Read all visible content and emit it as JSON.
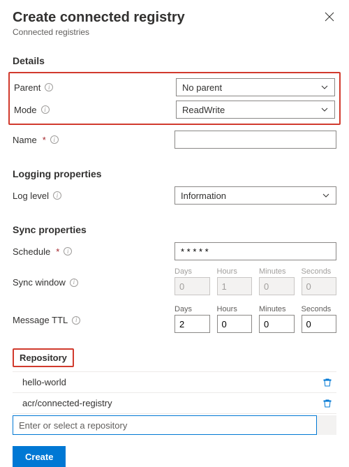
{
  "header": {
    "title": "Create connected registry",
    "subtitle": "Connected registries"
  },
  "sections": {
    "details": "Details",
    "logging": "Logging properties",
    "sync": "Sync properties"
  },
  "details": {
    "parent_label": "Parent",
    "parent_value": "No parent",
    "mode_label": "Mode",
    "mode_value": "ReadWrite",
    "name_label": "Name",
    "name_value": ""
  },
  "logging": {
    "loglevel_label": "Log level",
    "loglevel_value": "Information"
  },
  "sync": {
    "schedule_label": "Schedule",
    "schedule_value": "* * * * *",
    "syncwindow_label": "Sync window",
    "ttl_label": "Message TTL",
    "dur_labels": {
      "days": "Days",
      "hours": "Hours",
      "minutes": "Minutes",
      "seconds": "Seconds"
    },
    "sync_window": {
      "days": "0",
      "hours": "1",
      "minutes": "0",
      "seconds": "0"
    },
    "ttl": {
      "days": "2",
      "hours": "0",
      "minutes": "0",
      "seconds": "0"
    }
  },
  "repository": {
    "heading": "Repository",
    "items": [
      {
        "name": "hello-world"
      },
      {
        "name": "acr/connected-registry"
      }
    ],
    "input_placeholder": "Enter or select a repository"
  },
  "buttons": {
    "create": "Create"
  }
}
